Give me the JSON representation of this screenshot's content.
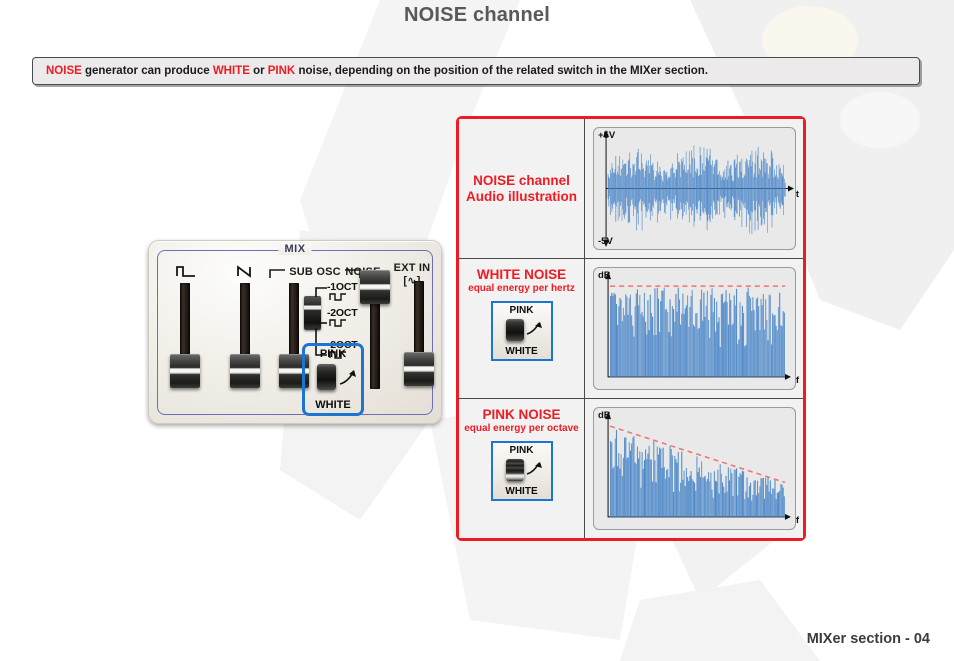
{
  "page": {
    "title": "NOISE channel",
    "footer": "MIXer section - 04"
  },
  "caption": {
    "segments": [
      {
        "text": "NOISE",
        "color": "#ed1c24"
      },
      {
        "text": " generator can produce ",
        "color": "#1a1a1a"
      },
      {
        "text": "WHITE",
        "color": "#ed1c24"
      },
      {
        "text": " or ",
        "color": "#1a1a1a"
      },
      {
        "text": "PINK",
        "color": "#ed1c24"
      },
      {
        "text": " noise, depending on the position of the related switch in the MIXer section.",
        "color": "#1a1a1a"
      }
    ],
    "plain": "NOISE generator can produce WHITE or PINK noise, depending on the position of the related switch in the MIXer section."
  },
  "mixer": {
    "section_label": "MIX",
    "channels": [
      {
        "name": "pulse-wave",
        "label": "",
        "glyph": "⊓",
        "x": 22,
        "cap_top": 106,
        "track_top": 38,
        "track_h": 74
      },
      {
        "name": "saw-wave",
        "label": "",
        "glyph": "↗",
        "x": 82,
        "cap_top": 106,
        "track_top": 38,
        "track_h": 74
      },
      {
        "name": "sub-osc",
        "label": "SUB OSC",
        "glyph": "",
        "x": 142,
        "cap_top": 106,
        "track_top": 38,
        "track_h": 74
      },
      {
        "name": "noise",
        "label": "NOISE",
        "glyph": "",
        "x": 202,
        "cap_top": 36,
        "track_top": 62,
        "track_h": 88
      },
      {
        "name": "ext-in",
        "label": "EXT IN",
        "glyph": "[∿]",
        "x": 256,
        "cap_top": 112,
        "track_top": 36,
        "track_h": 82
      }
    ],
    "sub_osc_label": "SUB OSC",
    "noise_label": "NOISE",
    "ext_in_label": "EXT IN",
    "ext_in_glyph": "[∿]",
    "octave_options": [
      "-1OCT",
      "-2OCT",
      "-2OCT"
    ],
    "pink_white": {
      "top_label": "PINK",
      "bottom_label": "WHITE",
      "position": "pink",
      "highlight_color": "#1b75d1"
    }
  },
  "illustrations": {
    "rows": [
      {
        "name": "noise-channel-audio",
        "title": "NOISE channel",
        "title2": "Audio illustration",
        "subtitle": "",
        "has_switch": false,
        "switch_position": "",
        "plot": "waveform",
        "axis_y": "+5V",
        "axis_y2": "-5V",
        "axis_x": "t"
      },
      {
        "name": "white-noise",
        "title": "WHITE NOISE",
        "title2": "",
        "subtitle": "equal energy per hertz",
        "has_switch": true,
        "switch_position": "pink",
        "plot": "flat-spectrum",
        "axis_y": "dB",
        "axis_y2": "",
        "axis_x": "f"
      },
      {
        "name": "pink-noise",
        "title": "PINK NOISE",
        "title2": "",
        "subtitle": "equal energy per octave",
        "has_switch": true,
        "switch_position": "white",
        "plot": "sloped-spectrum",
        "axis_y": "dB",
        "axis_y2": "",
        "axis_x": "f"
      }
    ],
    "switch_top_label": "PINK",
    "switch_bottom_label": "WHITE"
  },
  "chart_data": [
    {
      "type": "area",
      "name": "noise-channel-audio",
      "title": "NOISE channel Audio illustration",
      "xlabel": "t",
      "ylabel": "",
      "ylim": [
        -5,
        5
      ],
      "y_tick_labels": [
        "+5V",
        "-5V"
      ],
      "description": "Bipolar random noise waveform oscillating between +5V and -5V about a zero centerline",
      "grid": false,
      "series_color": "#4a86c8"
    },
    {
      "type": "bar",
      "name": "white-noise",
      "title": "WHITE NOISE",
      "subtitle": "equal energy per hertz",
      "xlabel": "f",
      "ylabel": "dB",
      "envelope": "flat",
      "envelope_color": "#f2726f",
      "description": "Spectrum of white noise: bar magnitudes randomly distributed beneath a flat horizontal envelope across all frequencies",
      "envelope_values": [
        100,
        100
      ],
      "grid": false,
      "series_color": "#4a86c8"
    },
    {
      "type": "bar",
      "name": "pink-noise",
      "title": "PINK NOISE",
      "subtitle": "equal energy per octave",
      "xlabel": "f",
      "ylabel": "dB",
      "envelope": "descending",
      "envelope_color": "#f2726f",
      "description": "Spectrum of pink noise: bar magnitudes decreasing with frequency beneath a linearly descending envelope (-3 dB per octave)",
      "envelope_values": [
        100,
        38
      ],
      "grid": false,
      "series_color": "#4a86c8"
    }
  ]
}
